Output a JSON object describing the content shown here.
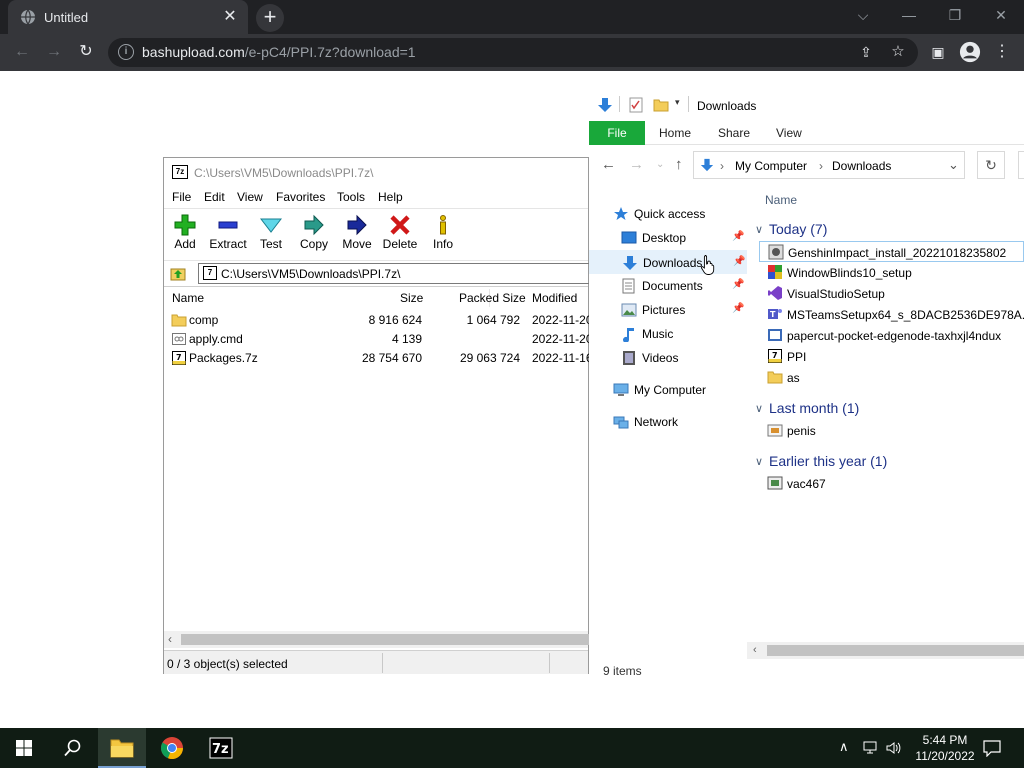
{
  "chrome": {
    "tab_title": "Untitled",
    "url_host": "bashupload.com",
    "url_path": "/e-pC4/PPI.7z?download=1"
  },
  "sevenzip": {
    "title": "C:\\Users\\VM5\\Downloads\\PPI.7z\\",
    "menu": [
      "File",
      "Edit",
      "View",
      "Favorites",
      "Tools",
      "Help"
    ],
    "toolbar": [
      "Add",
      "Extract",
      "Test",
      "Copy",
      "Move",
      "Delete",
      "Info"
    ],
    "address": "C:\\Users\\VM5\\Downloads\\PPI.7z\\",
    "columns": [
      "Name",
      "Size",
      "Packed Size",
      "Modified"
    ],
    "rows": [
      {
        "name": "comp",
        "size": "8 916 624",
        "packed": "1 064 792",
        "modified": "2022-11-20",
        "icon": "folder-icon"
      },
      {
        "name": "apply.cmd",
        "size": "4 139",
        "packed": "",
        "modified": "2022-11-20",
        "icon": "cmd-file-icon"
      },
      {
        "name": "Packages.7z",
        "size": "28 754 670",
        "packed": "29 063 724",
        "modified": "2022-11-16",
        "icon": "7z-archive-icon"
      }
    ],
    "status": "0 / 3 object(s) selected"
  },
  "explorer": {
    "title": "Downloads",
    "ribbon_file": "File",
    "ribbon_tabs": [
      "Home",
      "Share",
      "View"
    ],
    "breadcrumb": [
      "My Computer",
      "Downloads"
    ],
    "nav": {
      "quick_access": "Quick access",
      "items": [
        "Desktop",
        "Downloads",
        "Documents",
        "Pictures",
        "Music",
        "Videos"
      ],
      "my_computer": "My Computer",
      "network": "Network"
    },
    "column_name": "Name",
    "groups": [
      {
        "title": "Today (7)",
        "files": [
          "GenshinImpact_install_20221018235802",
          "WindowBlinds10_setup",
          "VisualStudioSetup",
          "MSTeamsSetupx64_s_8DACB2536DE978A...",
          "papercut-pocket-edgenode-taxhxjl4ndux",
          "PPI",
          "as"
        ]
      },
      {
        "title": "Last month (1)",
        "files": [
          "penis"
        ]
      },
      {
        "title": "Earlier this year (1)",
        "files": [
          "vac467"
        ]
      }
    ],
    "status": "9 items"
  },
  "taskbar": {
    "time": "5:44 PM",
    "date": "11/20/2022"
  }
}
